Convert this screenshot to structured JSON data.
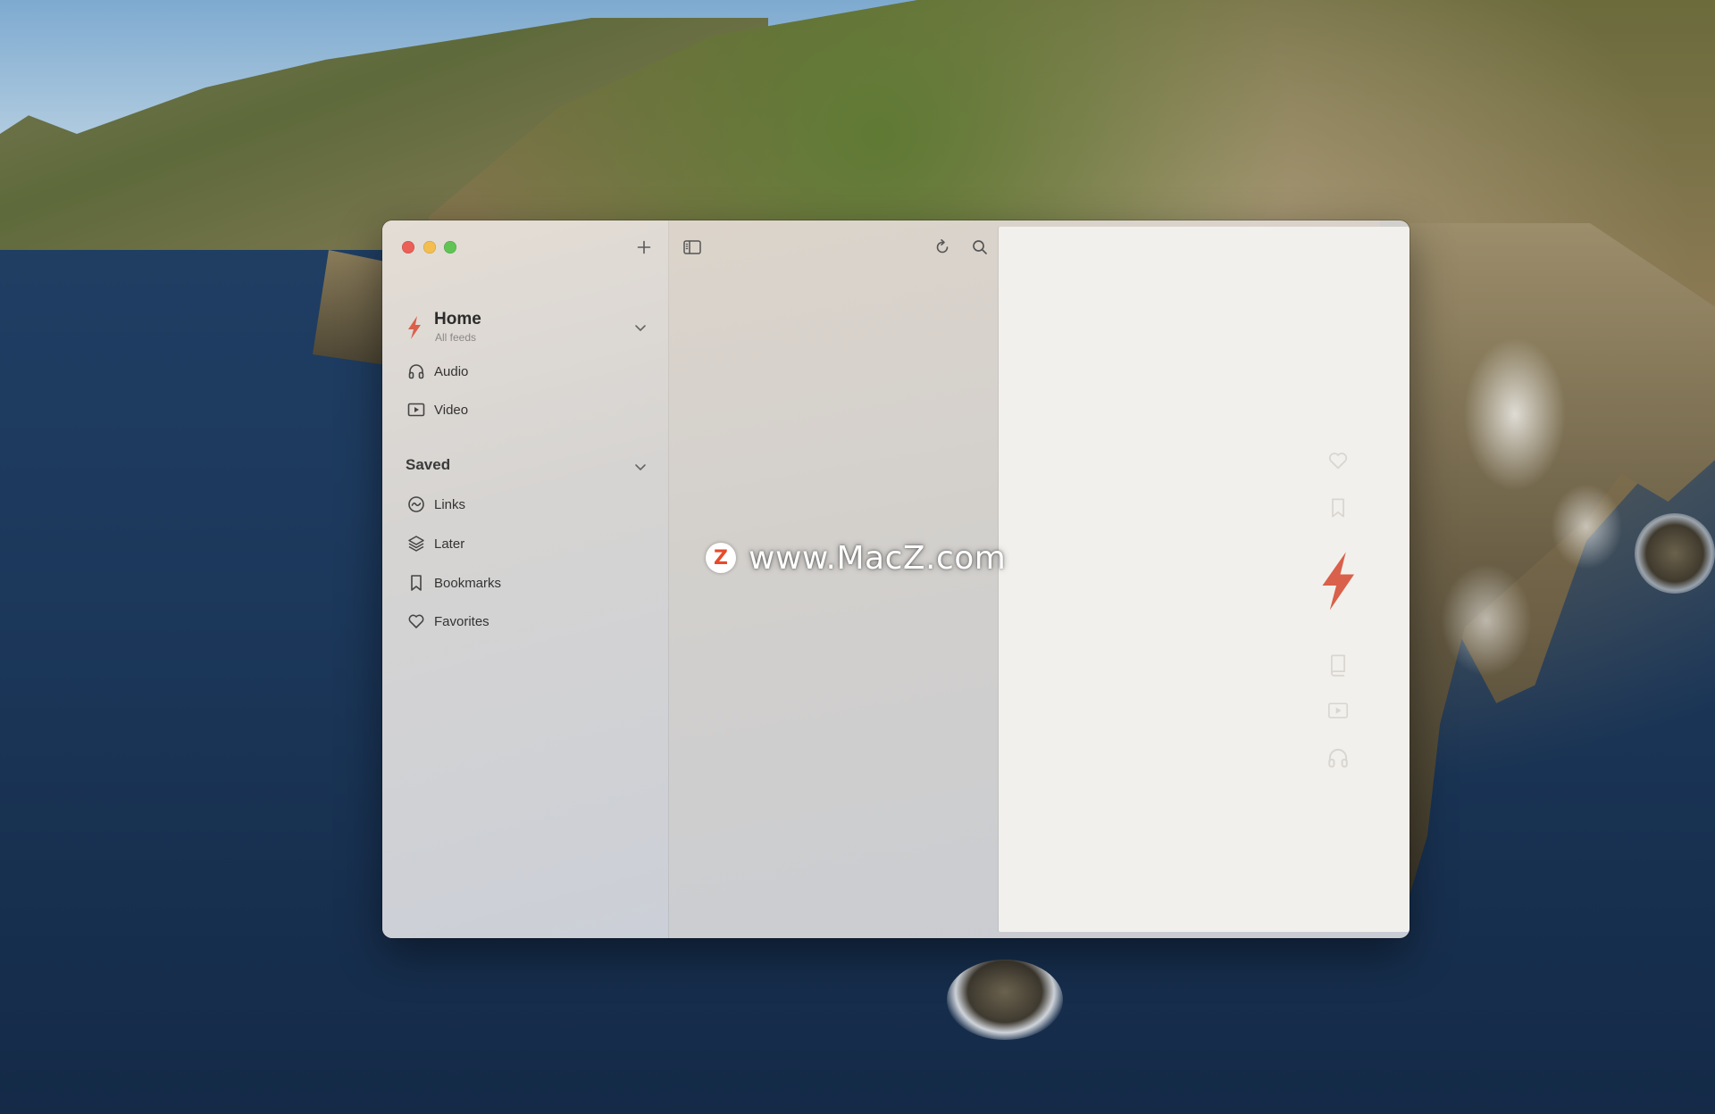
{
  "sidebar": {
    "home": {
      "title": "Home",
      "subtitle": "All feeds"
    },
    "feeds": [
      {
        "label": "Audio",
        "icon": "headphones-icon"
      },
      {
        "label": "Video",
        "icon": "video-icon"
      }
    ],
    "saved": {
      "title": "Saved",
      "items": [
        {
          "label": "Links",
          "icon": "link-circle-icon"
        },
        {
          "label": "Later",
          "icon": "layers-icon"
        },
        {
          "label": "Bookmarks",
          "icon": "bookmark-icon"
        },
        {
          "label": "Favorites",
          "icon": "heart-icon"
        }
      ]
    }
  },
  "reader": {
    "side_icons": [
      "heart-icon",
      "bookmark-icon",
      "bolt-icon",
      "book-icon",
      "video-icon",
      "headphones-icon"
    ]
  },
  "watermark": {
    "logo_letter": "Z",
    "text": "www.MacZ.com"
  },
  "colors": {
    "accent": "#d9604a",
    "traffic_close": "#ec5f56",
    "traffic_min": "#f4be4f",
    "traffic_max": "#5fc454"
  }
}
